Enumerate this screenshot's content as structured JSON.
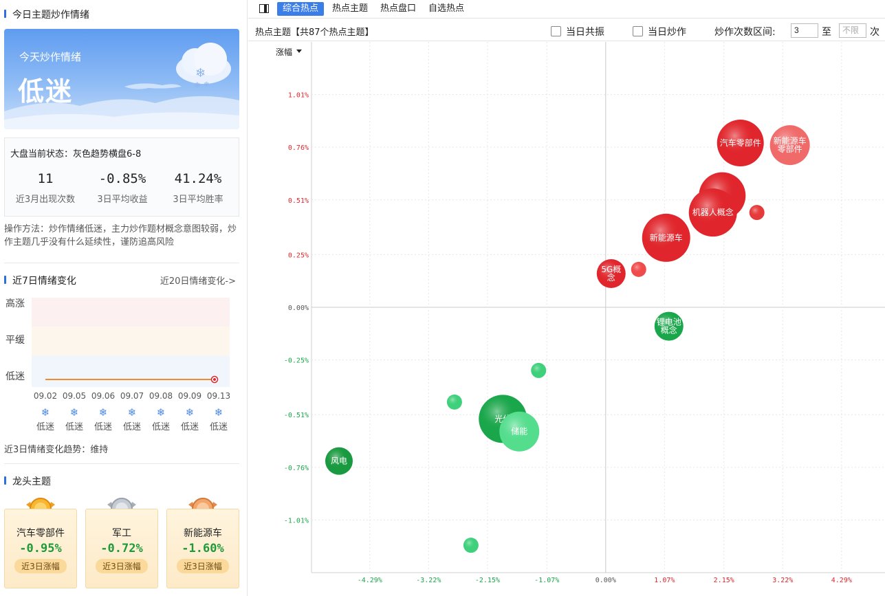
{
  "left": {
    "today_title": "今日主题炒作情绪",
    "banner": {
      "subtitle": "今天炒作情绪",
      "mood": "低迷"
    },
    "status": {
      "label": "大盘当前状态：灰色趋势横盘6-8",
      "stats": [
        {
          "value": "11",
          "label": "近3月出现次数"
        },
        {
          "value": "-0.85%",
          "label": "3日平均收益"
        },
        {
          "value": "41.24%",
          "label": "3日平均胜率"
        }
      ]
    },
    "method": "操作方法：炒作情绪低迷，主力炒作题材概念意图较弱，炒作主题几乎没有什么延续性，谨防追高风险",
    "week_title": "近7日情绪变化",
    "more_link": "近20日情绪变化->",
    "levels": [
      "高涨",
      "平缓",
      "低迷"
    ],
    "days": [
      {
        "date": "09.02",
        "mood": "低迷"
      },
      {
        "date": "09.05",
        "mood": "低迷"
      },
      {
        "date": "09.06",
        "mood": "低迷"
      },
      {
        "date": "09.07",
        "mood": "低迷"
      },
      {
        "date": "09.08",
        "mood": "低迷"
      },
      {
        "date": "09.09",
        "mood": "低迷"
      },
      {
        "date": "09.13",
        "mood": "低迷"
      }
    ],
    "trend": "近3日情绪变化趋势：维持",
    "leader_title": "龙头主题",
    "leaders": [
      {
        "name": "汽车零部件",
        "change": "-0.95%",
        "badge": "近3日涨幅",
        "medal": "gold"
      },
      {
        "name": "军工",
        "change": "-0.72%",
        "badge": "近3日涨幅",
        "medal": "silver"
      },
      {
        "name": "新能源车",
        "change": "-1.60%",
        "badge": "近3日涨幅",
        "medal": "bronze"
      }
    ]
  },
  "tabs": [
    "综合热点",
    "热点主题",
    "热点盘口",
    "自选热点"
  ],
  "active_tab": 0,
  "toolbar": {
    "title": "热点主题【共87个热点主题】",
    "opt1": "当日共振",
    "opt2": "当日炒作",
    "range_label": "炒作次数区间:",
    "range_from": "3",
    "range_sep": "至",
    "range_to_placeholder": "不限",
    "range_unit": "次"
  },
  "colors": {
    "up": "#e0262c",
    "down": "#1aa64a",
    "accent": "#3c7ee8"
  },
  "chart_data": {
    "type": "scatter",
    "ylabel": "涨幅",
    "y_ticks": [
      "1.01%",
      "0.76%",
      "0.51%",
      "0.25%",
      "0.00%",
      "-0.25%",
      "-0.51%",
      "-0.76%",
      "-1.01%"
    ],
    "x_ticks": [
      "-4.29%",
      "-3.22%",
      "-2.15%",
      "-1.07%",
      "0.00%",
      "1.07%",
      "2.15%",
      "3.22%",
      "4.29%"
    ],
    "xlim": [
      -5.35,
      5.08
    ],
    "ylim": [
      -1.26,
      1.26
    ],
    "points": [
      {
        "label": "汽车零部件",
        "x": 2.45,
        "y": 0.78,
        "size": 34,
        "color": "#e0262c"
      },
      {
        "label": "新能源车零部件",
        "x": 3.35,
        "y": 0.77,
        "size": 29,
        "color": "#f06a6a"
      },
      {
        "label": "",
        "x": 2.12,
        "y": 0.53,
        "size": 34,
        "color": "#e0262c"
      },
      {
        "label": "机器人概念",
        "x": 1.95,
        "y": 0.45,
        "size": 35,
        "color": "#e0262c"
      },
      {
        "label": "",
        "x": 2.75,
        "y": 0.45,
        "size": 11,
        "color": "#e63a3a"
      },
      {
        "label": "新能源车",
        "x": 1.1,
        "y": 0.33,
        "size": 35,
        "color": "#e0262c"
      },
      {
        "label": "5G概念",
        "x": 0.1,
        "y": 0.16,
        "size": 21,
        "color": "#e0262c"
      },
      {
        "label": "",
        "x": 0.6,
        "y": 0.18,
        "size": 11,
        "color": "#f04b4b"
      },
      {
        "label": "锂电池概念",
        "x": 1.15,
        "y": -0.09,
        "size": 21,
        "color": "#1aa64a"
      },
      {
        "label": "",
        "x": -1.22,
        "y": -0.3,
        "size": 11,
        "color": "#3ed07a"
      },
      {
        "label": "",
        "x": -2.75,
        "y": -0.45,
        "size": 11,
        "color": "#3ed07a"
      },
      {
        "label": "光伏",
        "x": -1.87,
        "y": -0.53,
        "size": 35,
        "color": "#1aa64a"
      },
      {
        "label": "储能",
        "x": -1.57,
        "y": -0.59,
        "size": 29,
        "color": "#55dd8e"
      },
      {
        "label": "风电",
        "x": -4.85,
        "y": -0.73,
        "size": 20,
        "color": "#1a9a40"
      },
      {
        "label": "",
        "x": -2.45,
        "y": -1.13,
        "size": 11,
        "color": "#3ed07a"
      }
    ]
  }
}
